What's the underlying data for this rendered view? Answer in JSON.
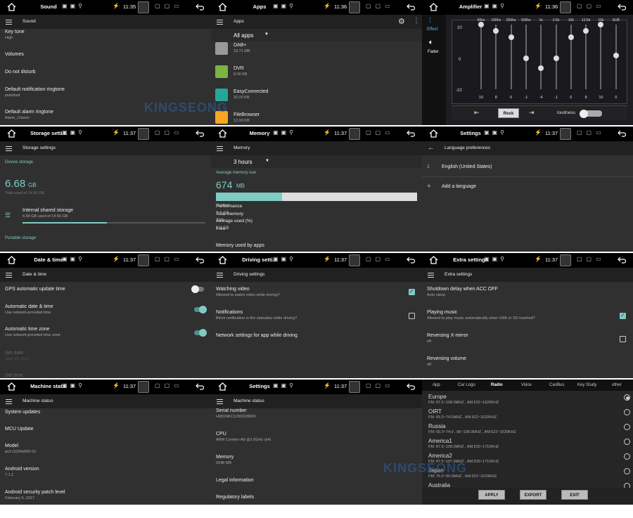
{
  "panels": {
    "sound": {
      "title": "Sound",
      "time": "11:35",
      "toolbar": "Sound",
      "items": [
        {
          "label": "Key tone",
          "sub": "High"
        },
        {
          "label": "Volumes",
          "sub": ""
        },
        {
          "label": "Do not disturb",
          "sub": ""
        },
        {
          "label": "Default notification ringtone",
          "sub": "pixiedust"
        },
        {
          "label": "Default alarm ringtone",
          "sub": "Alarm_Classic"
        }
      ]
    },
    "apps": {
      "title": "Apps",
      "time": "11:36",
      "toolbar": "Apps",
      "filter": "All apps",
      "items": [
        {
          "name": "DAB+",
          "size": "19.71 MB"
        },
        {
          "name": "DVR",
          "size": "8.00 KB"
        },
        {
          "name": "EasyConnected",
          "size": "20.00 KB"
        },
        {
          "name": "FileBrowser",
          "size": "12.00 KB"
        }
      ]
    },
    "amp": {
      "title": "Amplifier",
      "time": "11:36",
      "effect": "Effect",
      "fader": "Fader",
      "freqs": [
        "60hz",
        "100hz",
        "200hz",
        "500hz",
        "1k",
        "2.5k",
        "10k",
        "12.5k",
        "15k",
        "SUB"
      ],
      "scale": [
        "10",
        "0",
        "-10"
      ],
      "values": [
        "10",
        "8",
        "6",
        "-1",
        "-4",
        "-1",
        "6",
        "8",
        "10",
        "0"
      ],
      "preset": "Rock",
      "loudness": "loudness"
    },
    "storage": {
      "title": "Storage setti...",
      "time": "11:37",
      "toolbar": "Storage settings",
      "section": "Device storage",
      "used": "6.68",
      "unit": "GB",
      "total": "Total used of 14.56 GB",
      "internal": "Internal shared storage",
      "internal_sub": "6.68 GB used of 14.56 GB",
      "portable": "Portable storage",
      "fraction": 0.46
    },
    "memory": {
      "title": "Memory",
      "time": "11:37",
      "toolbar": "Memory",
      "period": "3 hours",
      "avg_label": "Average memory use",
      "avg": "674",
      "avg_unit": "MB",
      "fraction": 0.33,
      "rows": [
        {
          "k": "Performance",
          "v": "Normal"
        },
        {
          "k": "Total memory",
          "v": "2.0 GB"
        },
        {
          "k": "Average used (%)",
          "v": "33%"
        },
        {
          "k": "Free",
          "v": "1.3 GB"
        }
      ],
      "footer": "Memory used by apps"
    },
    "lang": {
      "title": "Settings",
      "time": "11:37",
      "toolbar": "Language preferences",
      "num": "1",
      "lang": "English (United States)",
      "add": "Add a language"
    },
    "date": {
      "title": "Date & time",
      "time": "11:37",
      "toolbar": "Date & time",
      "items": [
        {
          "label": "GPS automatic update time",
          "sub": ""
        },
        {
          "label": "Automatic date & time",
          "sub": "Use network-provided time"
        },
        {
          "label": "Automatic time zone",
          "sub": "Use network-provided time zone"
        },
        {
          "label": "Set date",
          "sub": "June 23, 2017"
        },
        {
          "label": "Set time",
          "sub": ""
        }
      ]
    },
    "driving": {
      "title": "Driving setti...",
      "time": "11:37",
      "toolbar": "Driving settings",
      "items": [
        {
          "label": "Watching video",
          "sub": "Allowed to watch video while driving?"
        },
        {
          "label": "Notifications",
          "sub": "Block notification in the statusbar while driving?"
        },
        {
          "label": "Network settings for app while driving",
          "sub": ""
        }
      ]
    },
    "extra": {
      "title": "Extra settings",
      "time": "11:37",
      "toolbar": "Extra settings",
      "items": [
        {
          "label": "Shutdown delay when ACC OFF",
          "sub": "Auto sleep"
        },
        {
          "label": "Playing music",
          "sub": "Allowed to play music automatically when USB or SD inserted?"
        },
        {
          "label": "Reversing X-mirror",
          "sub": "off"
        },
        {
          "label": "Reversing volume",
          "sub": "off"
        }
      ]
    },
    "machine": {
      "title": "Machine stat...",
      "time": "11:37",
      "toolbar": "Machine status",
      "items": [
        {
          "label": "System updates",
          "sub": ""
        },
        {
          "label": "MCU Update",
          "sub": ""
        },
        {
          "label": "Model",
          "sub": "px3 (1024x600 O)"
        },
        {
          "label": "Android version",
          "sub": "7.1.1"
        },
        {
          "label": "Android security patch level",
          "sub": "February 5, 2017"
        }
      ]
    },
    "machine2": {
      "title": "Settings",
      "time": "11:37",
      "toolbar": "Machine status",
      "items": [
        {
          "label": "Serial number",
          "sub": "H081NKC12001D8009"
        },
        {
          "label": "CPU",
          "sub": "ARM Coretex-A9 @1.6GHz (x4)"
        },
        {
          "label": "Memory",
          "sub": "2048 MB"
        },
        {
          "label": "Legal information",
          "sub": ""
        },
        {
          "label": "Regulatory labels",
          "sub": ""
        }
      ]
    },
    "radio": {
      "tabs": [
        "App",
        "Car Logo",
        "Radio",
        "Voice",
        "CanBus",
        "Key Study",
        "other"
      ],
      "regions": [
        {
          "name": "Europe",
          "band": "FM: 87.5~108.0MHZ , AM:522~1620KHZ"
        },
        {
          "name": "OIRT",
          "band": "FM: 65.0~74.0MHZ , AM:522~1620KHZ"
        },
        {
          "name": "Russia",
          "band": "FM: 65.0~74.0 , 88~108.0MHZ , AM:522~1620KHZ"
        },
        {
          "name": "America1",
          "band": "FM: 87.5~108.0MHZ , AM:530~1710KHZ"
        },
        {
          "name": "America2",
          "band": "FM: 87.5~107.9MHZ , AM:530~1710KHZ"
        },
        {
          "name": "Japan",
          "band": "FM: 76.0~90.0MHZ , AM:522~1629KHZ"
        },
        {
          "name": "Australia",
          "band": ""
        }
      ],
      "apply": "APPLY",
      "export": "EXPORT",
      "exit": "EXIT"
    }
  },
  "watermark": "KINGSEONG",
  "colors": {
    "accent": "#80cbc4",
    "bg": "#303030",
    "bar": "#212121"
  }
}
